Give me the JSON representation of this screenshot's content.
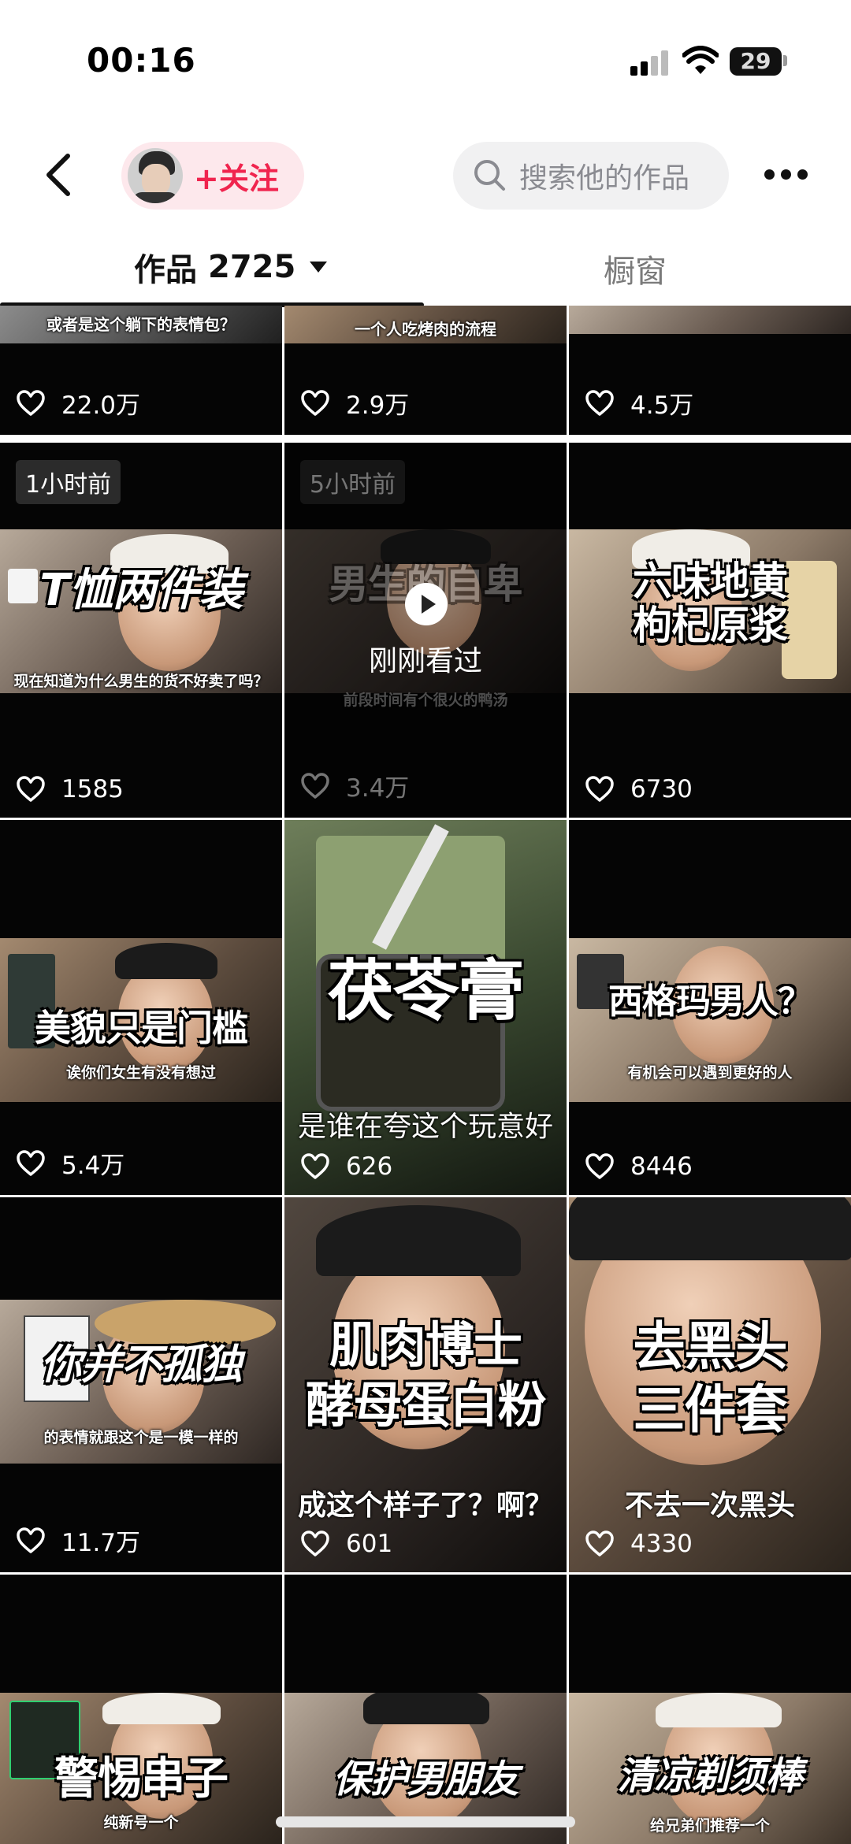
{
  "status_bar": {
    "time": "00:16",
    "battery": "29"
  },
  "header": {
    "follow_label": "+关注",
    "search_placeholder": "搜索他的作品"
  },
  "tabs": {
    "works_label": "作品",
    "works_count": "2725",
    "showcase_label": "橱窗"
  },
  "grid": [
    {
      "top_caption": "或者是这个躺下的表情包？",
      "likes": "22.0万"
    },
    {
      "top_caption": "一个人吃烤肉的流程",
      "likes": "2.9万"
    },
    {
      "top_caption": "",
      "likes": "4.5万"
    },
    {
      "badge": "1小时前",
      "caption": "T恤两件装",
      "sub": "现在知道为什么男生的货不好卖了吗？",
      "likes": "1585"
    },
    {
      "badge": "5小时前",
      "caption": "男生的自卑",
      "sub": "前段时间有个很火的鸭汤",
      "watched_label": "刚刚看过",
      "likes": "3.4万"
    },
    {
      "caption": "六味地黄\n枸杞原浆",
      "likes": "6730"
    },
    {
      "caption": "美貌只是门槛",
      "sub": "诶你们女生有没有想过",
      "likes": "5.4万"
    },
    {
      "caption": "茯苓膏",
      "sub": "是谁在夸这个玩意好",
      "likes": "626"
    },
    {
      "caption": "西格玛男人？",
      "sub": "有机会可以遇到更好的人",
      "likes": "8446"
    },
    {
      "caption": "你并不孤独",
      "sub": "的表情就跟这个是一模一样的",
      "likes": "11.7万"
    },
    {
      "caption": "肌肉博士\n酵母蛋白粉",
      "sub": "成这个样子了？啊？",
      "likes": "601"
    },
    {
      "caption": "去黑头\n三件套",
      "sub": "不去一次黑头",
      "likes": "4330"
    },
    {
      "caption": "警惕串子",
      "sub": "纯新号一个",
      "likes": ""
    },
    {
      "caption": "保护男朋友",
      "sub": "",
      "likes": ""
    },
    {
      "caption": "清凉剃须棒",
      "sub": "给兄弟们推荐一个",
      "likes": ""
    }
  ]
}
